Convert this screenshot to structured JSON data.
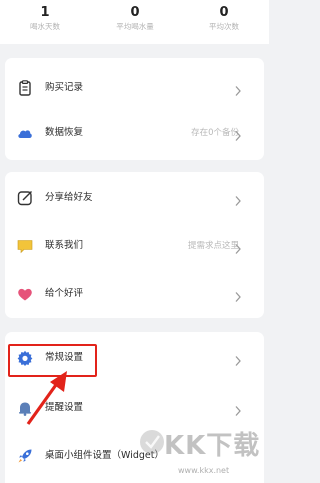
{
  "stats": [
    {
      "value": "1",
      "label": "喝水天数"
    },
    {
      "value": "0",
      "label": "平均喝水量"
    },
    {
      "value": "0",
      "label": "平均次数"
    }
  ],
  "group1": [
    {
      "label": "购买记录",
      "hint": ""
    },
    {
      "label": "数据恢复",
      "hint": "存在0个备份"
    }
  ],
  "group2": [
    {
      "label": "分享给好友",
      "hint": ""
    },
    {
      "label": "联系我们",
      "hint": "提需求点这里"
    },
    {
      "label": "给个好评",
      "hint": ""
    }
  ],
  "group3": [
    {
      "label": "常规设置",
      "hint": ""
    },
    {
      "label": "提醒设置",
      "hint": ""
    },
    {
      "label": "桌面小组件设置（Widget）",
      "hint": ""
    }
  ],
  "watermark": {
    "brand": "KK下载",
    "url": "www.kkx.net"
  },
  "colors": {
    "accent_red": "#e2231a",
    "icon_blue": "#3a6fd8",
    "icon_pink": "#e6537a",
    "icon_yellow": "#f2c43a"
  }
}
